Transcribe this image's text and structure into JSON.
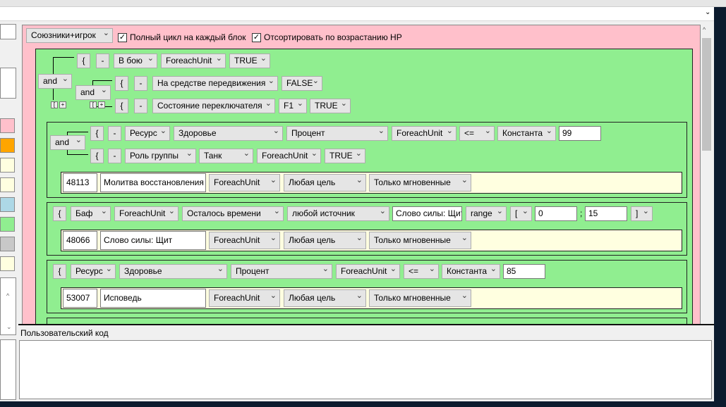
{
  "toolbar": {
    "group_select": "Союзники+игрок",
    "full_cycle_checked": true,
    "full_cycle_label": "Полный цикл на каждый блок",
    "sort_checked": true,
    "sort_label": "Отсортировать по возрастанию HP"
  },
  "block1": {
    "logic": "and",
    "row1": {
      "brace": "{",
      "minus": "-",
      "condition": "В бою",
      "target": "ForeachUnit",
      "value": "TRUE"
    },
    "sub_logic": "and",
    "row2": {
      "brace": "{",
      "minus": "-",
      "condition": "На средстве передвижения",
      "value": "FALSE"
    },
    "row3": {
      "brace": "{",
      "minus": "-",
      "condition": "Состояние переключателя",
      "key": "F1",
      "value": "TRUE"
    },
    "small_buttons": [
      "[",
      "+"
    ]
  },
  "block2": {
    "logic": "and",
    "row1": {
      "brace": "{",
      "minus": "-",
      "type": "Ресурс",
      "resource": "Здоровье",
      "mode": "Процент",
      "target": "ForeachUnit",
      "op": "<=",
      "kind": "Константа",
      "value": "99"
    },
    "row2": {
      "brace": "{",
      "minus": "-",
      "type": "Роль группы",
      "role": "Танк",
      "target": "ForeachUnit",
      "value": "TRUE"
    },
    "action": {
      "spell_id": "48113",
      "spell_name": "Молитва восстановления",
      "target": "ForeachUnit",
      "filter": "Любая цель",
      "cast": "Только мгновенные"
    }
  },
  "block3": {
    "row": {
      "brace": "{",
      "type": "Баф",
      "target": "ForeachUnit",
      "mode": "Осталось времени",
      "source": "любой источник",
      "spell": "Слово силы: Щит",
      "compare": "range",
      "bracket_open": "[",
      "from": "0",
      "sep": ";",
      "to": "15",
      "bracket_close": "]"
    },
    "action": {
      "spell_id": "48066",
      "spell_name": "Слово силы: Щит",
      "target": "ForeachUnit",
      "filter": "Любая цель",
      "cast": "Только мгновенные"
    }
  },
  "block4": {
    "row": {
      "brace": "{",
      "type": "Ресурс",
      "resource": "Здоровье",
      "mode": "Процент",
      "target": "ForeachUnit",
      "op": "<=",
      "kind": "Константа",
      "value": "85"
    },
    "action": {
      "spell_id": "53007",
      "spell_name": "Исповедь",
      "target": "ForeachUnit",
      "filter": "Любая цель",
      "cast": "Только мгновенные"
    }
  },
  "custom_code": {
    "label": "Пользовательский код",
    "value": ""
  },
  "colors": {
    "pink": "#ffc0cb",
    "green": "#90ee90",
    "yellow": "#ffffe0",
    "orange": "#ffa500",
    "blue": "#add8e6",
    "gray": "#c8c8c8"
  }
}
